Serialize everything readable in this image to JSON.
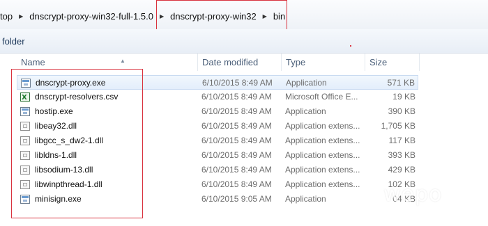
{
  "breadcrumb": {
    "items": [
      "top",
      "dnscrypt-proxy-win32-full-1.5.0",
      "dnscrypt-proxy-win32",
      "bin"
    ]
  },
  "toolbar": {
    "new_folder_label": "folder"
  },
  "columns": {
    "name": "Name",
    "date": "Date modified",
    "type": "Type",
    "size": "Size"
  },
  "files": [
    {
      "name": "dnscrypt-proxy.exe",
      "date": "6/10/2015 8:49 AM",
      "type": "Application",
      "size": "571 KB",
      "icon": "exe-icon"
    },
    {
      "name": "dnscrypt-resolvers.csv",
      "date": "6/10/2015 8:49 AM",
      "type": "Microsoft Office E...",
      "size": "19 KB",
      "icon": "excel-csv-icon"
    },
    {
      "name": "hostip.exe",
      "date": "6/10/2015 8:49 AM",
      "type": "Application",
      "size": "390 KB",
      "icon": "exe-icon"
    },
    {
      "name": "libeay32.dll",
      "date": "6/10/2015 8:49 AM",
      "type": "Application extens...",
      "size": "1,705 KB",
      "icon": "dll-icon"
    },
    {
      "name": "libgcc_s_dw2-1.dll",
      "date": "6/10/2015 8:49 AM",
      "type": "Application extens...",
      "size": "117 KB",
      "icon": "dll-icon"
    },
    {
      "name": "libldns-1.dll",
      "date": "6/10/2015 8:49 AM",
      "type": "Application extens...",
      "size": "393 KB",
      "icon": "dll-icon"
    },
    {
      "name": "libsodium-13.dll",
      "date": "6/10/2015 8:49 AM",
      "type": "Application extens...",
      "size": "429 KB",
      "icon": "dll-icon"
    },
    {
      "name": "libwinpthread-1.dll",
      "date": "6/10/2015 8:49 AM",
      "type": "Application extens...",
      "size": "102 KB",
      "icon": "dll-icon"
    },
    {
      "name": "minisign.exe",
      "date": "6/10/2015 9:05 AM",
      "type": "Application",
      "size": "04 KB",
      "icon": "exe-icon"
    }
  ],
  "watermark": "wepo",
  "colors": {
    "highlight_box": "#d9333f",
    "selection_bg": "#e3eefb",
    "header_text": "#4c607a"
  }
}
